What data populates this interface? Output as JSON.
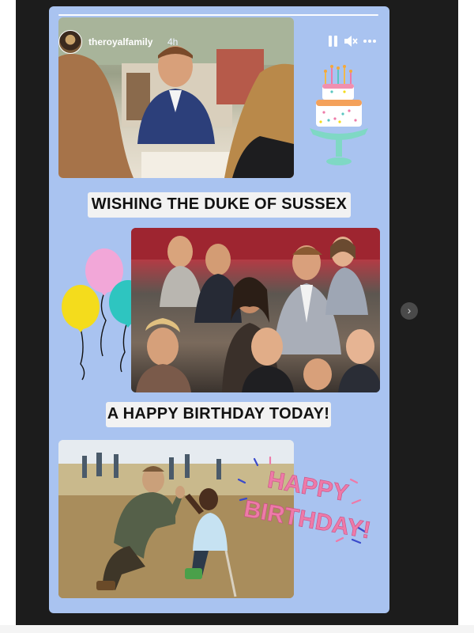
{
  "story": {
    "username": "theroyalfamily",
    "time_ago": "4h",
    "banner_top": "WISHING THE DUKE OF SUSSEX",
    "banner_middle": "A HAPPY BIRTHDAY TODAY!",
    "sticker_text_line1": "HAPPY",
    "sticker_text_line2": "BIRTHDAY!"
  },
  "icons": {
    "pause": "pause-icon",
    "mute": "muted-speaker-icon",
    "more": "more-icon",
    "next": "chevron-right-icon"
  },
  "colors": {
    "story_background": "#a9c3f0",
    "banner_background": "#f2f2f2",
    "sticker_pink": "#ee7aa8",
    "balloon_yellow": "#f4dc1c",
    "balloon_pink": "#f2a7d8",
    "balloon_teal": "#2ec5c0"
  }
}
